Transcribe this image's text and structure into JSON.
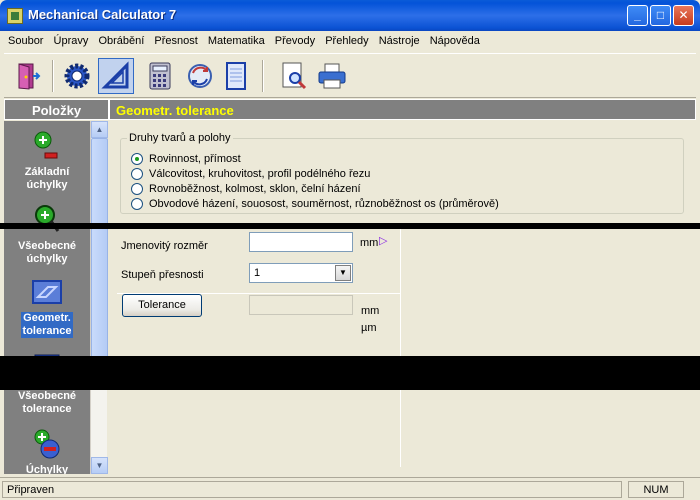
{
  "window": {
    "title": "Mechanical Calculator 7",
    "minimize": "_",
    "maximize": "□",
    "close": "✕"
  },
  "menu": [
    "Soubor",
    "Úpravy",
    "Obrábění",
    "Přesnost",
    "Matematika",
    "Převody",
    "Přehledy",
    "Nástroje",
    "Nápověda"
  ],
  "toolbar": {
    "icons": [
      "door-exit-icon",
      "gear-settings-icon",
      "triangle-tolerance-icon",
      "calculator-icon",
      "convert-cycle-icon",
      "notebook-icon",
      "preview-magnifier-icon",
      "printer-icon"
    ],
    "active": "triangle-tolerance-icon"
  },
  "left_panel": {
    "header": "Položky",
    "items": [
      {
        "label_1": "Základní",
        "label_2": "úchylky",
        "icon": "plus-minus-icon",
        "selected": false
      },
      {
        "label_1": "Všeobecné",
        "label_2": "úchylky",
        "icon": "wrench-tolerance-icon",
        "selected": false
      },
      {
        "label_1": "Geometr.",
        "label_2": "tolerance",
        "icon": "geometric-tolerance-icon",
        "selected": true
      },
      {
        "label_1": "Všeobecné",
        "label_2": "tolerance",
        "icon": "general-tolerance-icon",
        "selected": false
      },
      {
        "label_1": "Úchylky",
        "label_2": "",
        "icon": "deviation-icon",
        "selected": false
      }
    ],
    "scroll_up": "▲",
    "scroll_down": "▼"
  },
  "main": {
    "header": "Geometr. tolerance",
    "group": {
      "legend": "Druhy tvarů a polohy",
      "options": [
        {
          "label": "Rovinnost, přímost",
          "checked": true
        },
        {
          "label": "Válcovitost, kruhovitost, profil podélného řezu",
          "checked": false
        },
        {
          "label": "Rovnoběžnost, kolmost, sklon, čelní házení",
          "checked": false
        },
        {
          "label": "Obvodové házení, souosost, souměrnost, různoběžnost os (průměrově)",
          "checked": false
        }
      ]
    },
    "nominal_label": "Jmenovitý rozměr",
    "nominal_value": "",
    "nominal_unit": "mm",
    "grade_label": "Stupeň přesnosti",
    "grade_value": "1",
    "tolerance_button": "Tolerance",
    "tolerance_value": "",
    "unit_mm": "mm",
    "unit_um": "µm"
  },
  "status": {
    "text": "Připraven",
    "num": "NUM"
  },
  "colors": {
    "title_bar": "#0a5bd8",
    "panel_header": "#808080",
    "main_header_text": "#ffff00",
    "selection": "#316ac5"
  }
}
